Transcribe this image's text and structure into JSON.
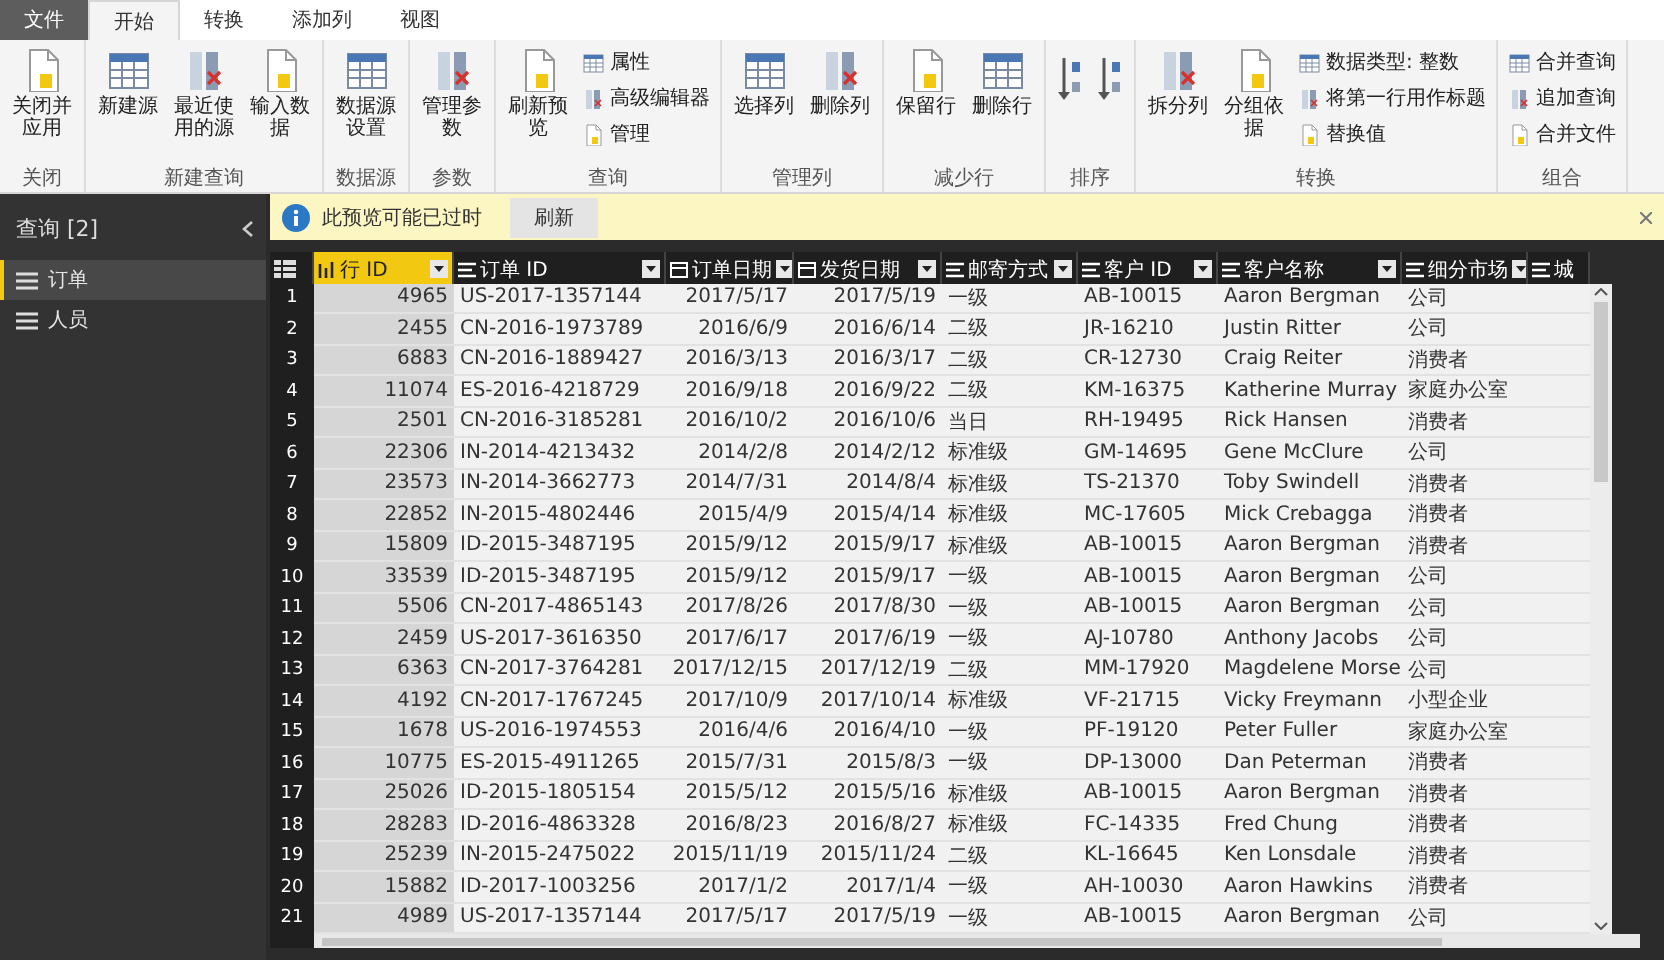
{
  "tabs": [
    {
      "label": "文件",
      "kind": "file",
      "selected": false
    },
    {
      "label": "开始",
      "kind": "tab",
      "selected": true
    },
    {
      "label": "转换",
      "kind": "tab",
      "selected": false
    },
    {
      "label": "添加列",
      "kind": "tab",
      "selected": false
    },
    {
      "label": "视图",
      "kind": "tab",
      "selected": false
    }
  ],
  "ribbon": {
    "groups": [
      {
        "label": "关闭",
        "buttons": [
          {
            "label": "关闭并应用",
            "kind": "large"
          }
        ]
      },
      {
        "label": "新建查询",
        "buttons": [
          {
            "label": "新建源",
            "kind": "large"
          },
          {
            "label": "最近使用的源",
            "kind": "large"
          },
          {
            "label": "输入数据",
            "kind": "large"
          }
        ]
      },
      {
        "label": "数据源",
        "buttons": [
          {
            "label": "数据源设置",
            "kind": "large"
          }
        ]
      },
      {
        "label": "参数",
        "buttons": [
          {
            "label": "管理参数",
            "kind": "large"
          }
        ]
      },
      {
        "label": "查询",
        "buttons": [
          {
            "label": "刷新预览",
            "kind": "large"
          },
          {
            "label": "属性",
            "kind": "small"
          },
          {
            "label": "高级编辑器",
            "kind": "small"
          },
          {
            "label": "管理",
            "kind": "small"
          }
        ]
      },
      {
        "label": "管理列",
        "buttons": [
          {
            "label": "选择列",
            "kind": "large"
          },
          {
            "label": "删除列",
            "kind": "large"
          }
        ]
      },
      {
        "label": "减少行",
        "buttons": [
          {
            "label": "保留行",
            "kind": "large"
          },
          {
            "label": "删除行",
            "kind": "large"
          }
        ]
      },
      {
        "label": "排序",
        "buttons": [
          {
            "kind": "icon"
          },
          {
            "kind": "icon"
          }
        ]
      },
      {
        "label": "转换",
        "buttons": [
          {
            "label": "拆分列",
            "kind": "large"
          },
          {
            "label": "分组依据",
            "kind": "large"
          },
          {
            "label": "数据类型: 整数",
            "kind": "small"
          },
          {
            "label": "将第一行用作标题",
            "kind": "small"
          },
          {
            "label": "替换值",
            "kind": "small"
          }
        ]
      },
      {
        "label": "组合",
        "buttons": [
          {
            "label": "合并查询",
            "kind": "small"
          },
          {
            "label": "追加查询",
            "kind": "small"
          },
          {
            "label": "合并文件",
            "kind": "small"
          }
        ]
      }
    ]
  },
  "sidebar": {
    "title": "查询 [2]",
    "items": [
      {
        "label": "订单",
        "selected": true
      },
      {
        "label": "人员",
        "selected": false
      }
    ]
  },
  "infobar": {
    "message": "此预览可能已过时",
    "button": "刷新"
  },
  "table": {
    "columns": [
      {
        "name": "行 ID",
        "kind": "number",
        "selected": true
      },
      {
        "name": "订单 ID",
        "kind": "text",
        "selected": false
      },
      {
        "name": "订单日期",
        "kind": "date",
        "selected": false
      },
      {
        "name": "发货日期",
        "kind": "date",
        "selected": false
      },
      {
        "name": "邮寄方式",
        "kind": "text",
        "selected": false
      },
      {
        "name": "客户 ID",
        "kind": "text",
        "selected": false
      },
      {
        "name": "客户名称",
        "kind": "text",
        "selected": false
      },
      {
        "name": "细分市场",
        "kind": "text",
        "selected": false
      },
      {
        "name": "城",
        "kind": "text",
        "selected": false
      }
    ],
    "row_numbers": [
      "1",
      "2",
      "3",
      "4",
      "5",
      "6",
      "7",
      "8",
      "9",
      "10",
      "11",
      "12",
      "13",
      "14",
      "15",
      "16",
      "17",
      "18",
      "19",
      "20",
      "21"
    ],
    "rows": [
      [
        "4965",
        "US-2017-1357144",
        "2017/5/17",
        "2017/5/19",
        "一级",
        "AB-10015",
        "Aaron Bergman",
        "公司"
      ],
      [
        "2455",
        "CN-2016-1973789",
        "2016/6/9",
        "2016/6/14",
        "二级",
        "JR-16210",
        "Justin Ritter",
        "公司"
      ],
      [
        "6883",
        "CN-2016-1889427",
        "2016/3/13",
        "2016/3/17",
        "二级",
        "CR-12730",
        "Craig Reiter",
        "消费者"
      ],
      [
        "11074",
        "ES-2016-4218729",
        "2016/9/18",
        "2016/9/22",
        "二级",
        "KM-16375",
        "Katherine Murray",
        "家庭办公室"
      ],
      [
        "2501",
        "CN-2016-3185281",
        "2016/10/2",
        "2016/10/6",
        "当日",
        "RH-19495",
        "Rick Hansen",
        "消费者"
      ],
      [
        "22306",
        "IN-2014-4213432",
        "2014/2/8",
        "2014/2/12",
        "标准级",
        "GM-14695",
        "Gene McClure",
        "公司"
      ],
      [
        "23573",
        "IN-2014-3662773",
        "2014/7/31",
        "2014/8/4",
        "标准级",
        "TS-21370",
        "Toby Swindell",
        "消费者"
      ],
      [
        "22852",
        "IN-2015-4802446",
        "2015/4/9",
        "2015/4/14",
        "标准级",
        "MC-17605",
        "Mick Crebagga",
        "消费者"
      ],
      [
        "15809",
        "ID-2015-3487195",
        "2015/9/12",
        "2015/9/17",
        "标准级",
        "AB-10015",
        "Aaron Bergman",
        "消费者"
      ],
      [
        "33539",
        "ID-2015-3487195",
        "2015/9/12",
        "2015/9/17",
        "一级",
        "AB-10015",
        "Aaron Bergman",
        "公司"
      ],
      [
        "5506",
        "CN-2017-4865143",
        "2017/8/26",
        "2017/8/30",
        "一级",
        "AB-10015",
        "Aaron Bergman",
        "公司"
      ],
      [
        "2459",
        "US-2017-3616350",
        "2017/6/17",
        "2017/6/19",
        "一级",
        "AJ-10780",
        "Anthony Jacobs",
        "公司"
      ],
      [
        "6363",
        "CN-2017-3764281",
        "2017/12/15",
        "2017/12/19",
        "二级",
        "MM-17920",
        "Magdelene Morse",
        "公司"
      ],
      [
        "4192",
        "CN-2017-1767245",
        "2017/10/9",
        "2017/10/14",
        "标准级",
        "VF-21715",
        "Vicky Freymann",
        "小型企业"
      ],
      [
        "1678",
        "US-2016-1974553",
        "2016/4/6",
        "2016/4/10",
        "一级",
        "PF-19120",
        "Peter Fuller",
        "家庭办公室"
      ],
      [
        "10775",
        "ES-2015-4911265",
        "2015/7/31",
        "2015/8/3",
        "一级",
        "DP-13000",
        "Dan Peterman",
        "消费者"
      ],
      [
        "25026",
        "ID-2015-1805154",
        "2015/5/12",
        "2015/5/16",
        "标准级",
        "AB-10015",
        "Aaron Bergman",
        "消费者"
      ],
      [
        "28283",
        "ID-2016-4863328",
        "2016/8/23",
        "2016/8/27",
        "标准级",
        "FC-14335",
        "Fred Chung",
        "消费者"
      ],
      [
        "25239",
        "IN-2015-2475022",
        "2015/11/19",
        "2015/11/24",
        "二级",
        "KL-16645",
        "Ken Lonsdale",
        "消费者"
      ],
      [
        "15882",
        "ID-2017-1003256",
        "2017/1/2",
        "2017/1/4",
        "一级",
        "AH-10030",
        "Aaron Hawkins",
        "消费者"
      ],
      [
        "4989",
        "US-2017-1357144",
        "2017/5/17",
        "2017/5/19",
        "一级",
        "AB-10015",
        "Aaron Bergman",
        "公司"
      ]
    ]
  }
}
